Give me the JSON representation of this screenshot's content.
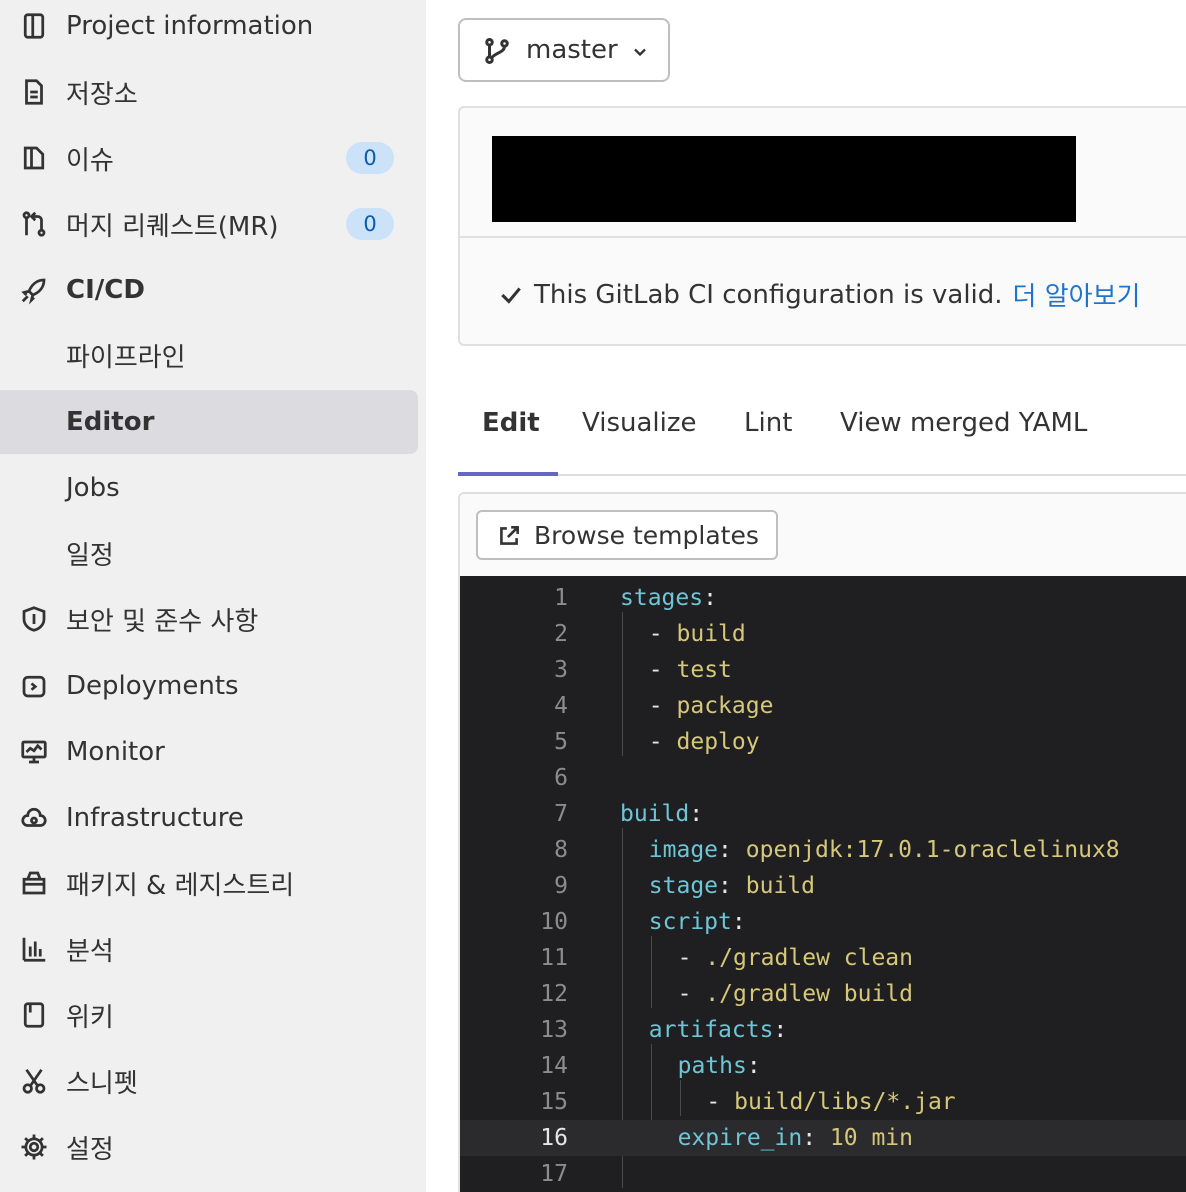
{
  "sidebar": {
    "items": [
      {
        "label": "Project information",
        "icon": "info-icon"
      },
      {
        "label": "저장소",
        "icon": "document-icon"
      },
      {
        "label": "이슈",
        "icon": "issues-icon",
        "badge": "0"
      },
      {
        "label": "머지 리퀘스트(MR)",
        "icon": "merge-request-icon",
        "badge": "0"
      },
      {
        "label": "CI/CD",
        "icon": "rocket-icon"
      },
      {
        "label": "파이프라인"
      },
      {
        "label": "Editor"
      },
      {
        "label": "Jobs"
      },
      {
        "label": "일정"
      },
      {
        "label": "보안 및 준수 사항",
        "icon": "shield-icon"
      },
      {
        "label": "Deployments",
        "icon": "deployments-icon"
      },
      {
        "label": "Monitor",
        "icon": "monitor-icon"
      },
      {
        "label": "Infrastructure",
        "icon": "cloud-icon"
      },
      {
        "label": "패키지 & 레지스트리",
        "icon": "package-icon"
      },
      {
        "label": "분석",
        "icon": "chart-icon"
      },
      {
        "label": "위키",
        "icon": "book-icon"
      },
      {
        "label": "스니펫",
        "icon": "scissors-icon"
      },
      {
        "label": "설정",
        "icon": "gear-icon"
      }
    ]
  },
  "branch": {
    "label": "master",
    "icon": "branch-icon"
  },
  "status": {
    "message": "This GitLab CI configuration is valid.",
    "learn_more": "더 알아보기",
    "icon": "check-icon"
  },
  "tabs": [
    "Edit",
    "Visualize",
    "Lint",
    "View merged YAML"
  ],
  "browse_templates": "Browse templates",
  "code": {
    "line_numbers": [
      "1",
      "2",
      "3",
      "4",
      "5",
      "6",
      "7",
      "8",
      "9",
      "10",
      "11",
      "12",
      "13",
      "14",
      "15",
      "16",
      "17"
    ],
    "lines": [
      {
        "key": "stages",
        "sep": ":",
        "val": ""
      },
      {
        "dash": "- ",
        "val": "build"
      },
      {
        "dash": "- ",
        "val": "test"
      },
      {
        "dash": "- ",
        "val": "package"
      },
      {
        "dash": "- ",
        "val": "deploy"
      },
      {},
      {
        "key": "build",
        "sep": ":",
        "val": ""
      },
      {
        "key": "image",
        "sep": ": ",
        "val": "openjdk:17.0.1-oraclelinux8"
      },
      {
        "key": "stage",
        "sep": ": ",
        "val": "build"
      },
      {
        "key": "script",
        "sep": ":",
        "val": ""
      },
      {
        "dash": "- ",
        "val": "./gradlew clean"
      },
      {
        "dash": "- ",
        "val": "./gradlew build"
      },
      {
        "key": "artifacts",
        "sep": ":",
        "val": ""
      },
      {
        "key": "paths",
        "sep": ":",
        "val": ""
      },
      {
        "dash": "- ",
        "val": "build/libs/*.jar"
      },
      {
        "key": "expire_in",
        "sep": ": ",
        "val": "10 min"
      },
      {}
    ],
    "current_line": "16"
  },
  "colors": {
    "sidebar_bg": "#f0f0f0",
    "active_item_bg": "#dbdbe0",
    "badge_bg": "#cbe2f9",
    "link": "#1f75cb",
    "tab_underline": "#6666c4",
    "editor_bg": "#1f1f21",
    "yaml_key": "#6ec5d6",
    "yaml_value": "#d6c77a"
  }
}
